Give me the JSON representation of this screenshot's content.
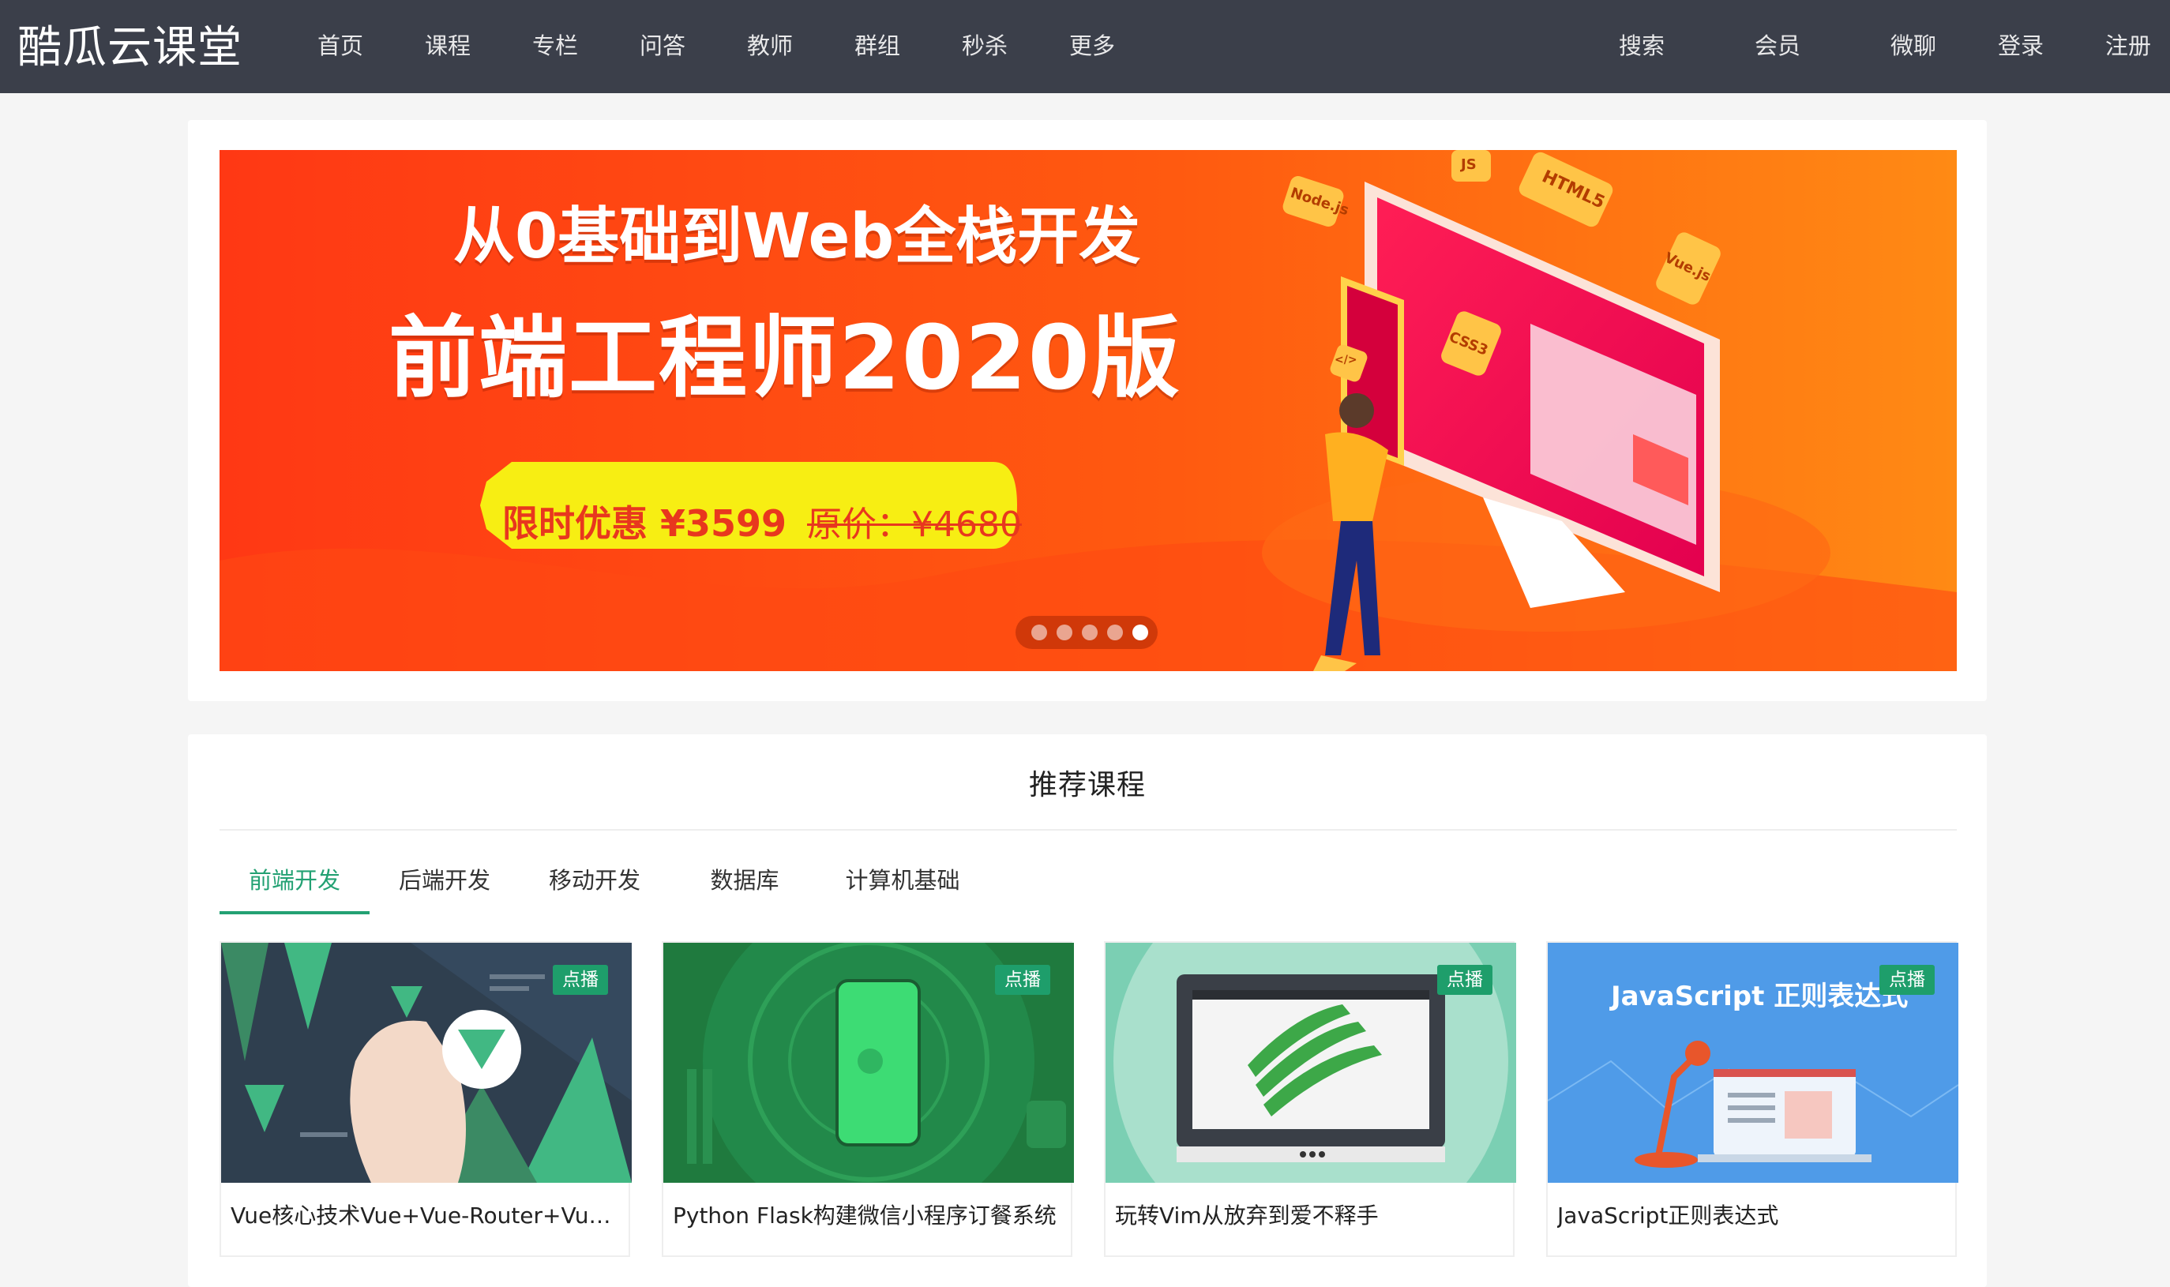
{
  "brand": "酷瓜云课堂",
  "nav": {
    "items": [
      "首页",
      "课程",
      "专栏",
      "问答",
      "教师",
      "群组",
      "秒杀",
      "更多"
    ],
    "right": [
      "搜索",
      "会员",
      "微聊",
      "登录",
      "注册"
    ]
  },
  "banner": {
    "line1": "从0基础到Web全栈开发",
    "line2": "前端工程师2020版",
    "promo": "限时优惠 ¥3599",
    "original_price": "原价：¥4680",
    "slides": 5,
    "active_slide": 5,
    "tech_labels": [
      "Node.js",
      "HTML5",
      "Vue.js",
      "CSS3",
      "</>",
      "JS"
    ],
    "colors": {
      "orange": "#ff7a12",
      "red": "#ff3814",
      "yellow": "#f7ee13"
    }
  },
  "recommend": {
    "title": "推荐课程",
    "tabs": [
      "前端开发",
      "后端开发",
      "移动开发",
      "数据库",
      "计算机基础"
    ],
    "active_tab": 0,
    "accent": "#23a173",
    "courses": [
      {
        "title": "Vue核心技术Vue+Vue-Router+Vuex+...",
        "badge": "点播"
      },
      {
        "title": "Python Flask构建微信小程序订餐系统",
        "badge": "点播"
      },
      {
        "title": "玩转Vim从放弃到爱不释手",
        "badge": "点播"
      },
      {
        "title": "JavaScript正则表达式",
        "badge": "点播",
        "cover_text": "JavaScript 正则表达式"
      }
    ]
  }
}
